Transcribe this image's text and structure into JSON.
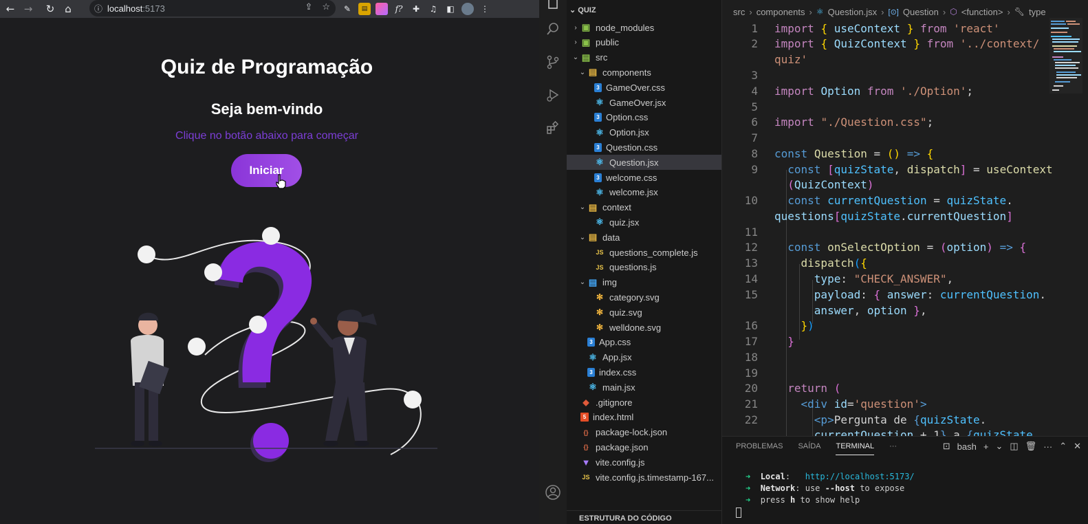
{
  "browser": {
    "url_host": "localhost",
    "url_port": ":5173"
  },
  "app": {
    "title": "Quiz de Programação",
    "welcome": "Seja bem-vindo",
    "subtitle": "Clique no botão abaixo para começar",
    "start_button": "Iniciar"
  },
  "explorer": {
    "header": "QUIZ",
    "outline_label": "ESTRUTURA DO CÓDIGO",
    "items": [
      {
        "label": "node_modules",
        "icon": "folder-icon"
      },
      {
        "label": "public",
        "icon": "folder-icon"
      },
      {
        "label": "src",
        "icon": "folder-open-icon"
      },
      {
        "label": "components",
        "icon": "folder-open-icon"
      },
      {
        "label": "GameOver.css",
        "icon": "css-icon"
      },
      {
        "label": "GameOver.jsx",
        "icon": "react-icon"
      },
      {
        "label": "Option.css",
        "icon": "css-icon"
      },
      {
        "label": "Option.jsx",
        "icon": "react-icon"
      },
      {
        "label": "Question.css",
        "icon": "css-icon"
      },
      {
        "label": "Question.jsx",
        "icon": "react-icon"
      },
      {
        "label": "welcome.css",
        "icon": "css-icon"
      },
      {
        "label": "welcome.jsx",
        "icon": "react-icon"
      },
      {
        "label": "context",
        "icon": "folder-open-icon"
      },
      {
        "label": "quiz.jsx",
        "icon": "react-icon"
      },
      {
        "label": "data",
        "icon": "folder-open-icon"
      },
      {
        "label": "questions_complete.js",
        "icon": "js-icon"
      },
      {
        "label": "questions.js",
        "icon": "js-icon"
      },
      {
        "label": "img",
        "icon": "folder-open-icon"
      },
      {
        "label": "category.svg",
        "icon": "svg-icon"
      },
      {
        "label": "quiz.svg",
        "icon": "svg-icon"
      },
      {
        "label": "welldone.svg",
        "icon": "svg-icon"
      },
      {
        "label": "App.css",
        "icon": "css-icon"
      },
      {
        "label": "App.jsx",
        "icon": "react-icon"
      },
      {
        "label": "index.css",
        "icon": "css-icon"
      },
      {
        "label": "main.jsx",
        "icon": "react-icon"
      },
      {
        "label": ".gitignore",
        "icon": "git-icon"
      },
      {
        "label": "index.html",
        "icon": "html-icon"
      },
      {
        "label": "package-lock.json",
        "icon": "json-icon"
      },
      {
        "label": "package.json",
        "icon": "json-icon"
      },
      {
        "label": "vite.config.js",
        "icon": "vite-icon"
      },
      {
        "label": "vite.config.js.timestamp-167...",
        "icon": "js-icon"
      }
    ]
  },
  "editor": {
    "breadcrumb": [
      "src",
      "components",
      "Question.jsx",
      "Question",
      "<function>",
      "type"
    ],
    "line_numbers": [
      "1",
      "2",
      "",
      "3",
      "4",
      "5",
      "6",
      "7",
      "8",
      "9",
      "",
      "10",
      "",
      "11",
      "12",
      "13",
      "14",
      "15",
      "",
      "16",
      "17",
      "18",
      "19",
      "20",
      "21",
      "22",
      ""
    ]
  },
  "panel": {
    "tabs": [
      "PROBLEMAS",
      "SAÍDA",
      "TERMINAL"
    ],
    "more": "···",
    "shell": "bash",
    "terminal": {
      "local_label": "Local",
      "local_url": "http://localhost:5173/",
      "network_label": "Network",
      "network_text_1": ": use ",
      "network_flag": "--host",
      "network_text_2": " to expose",
      "help_text_1": "press ",
      "help_key": "h",
      "help_text_2": " to show help"
    }
  },
  "colors": {
    "accent_purple": "#8a35d8",
    "subtitle_purple": "#7c3ed6"
  }
}
